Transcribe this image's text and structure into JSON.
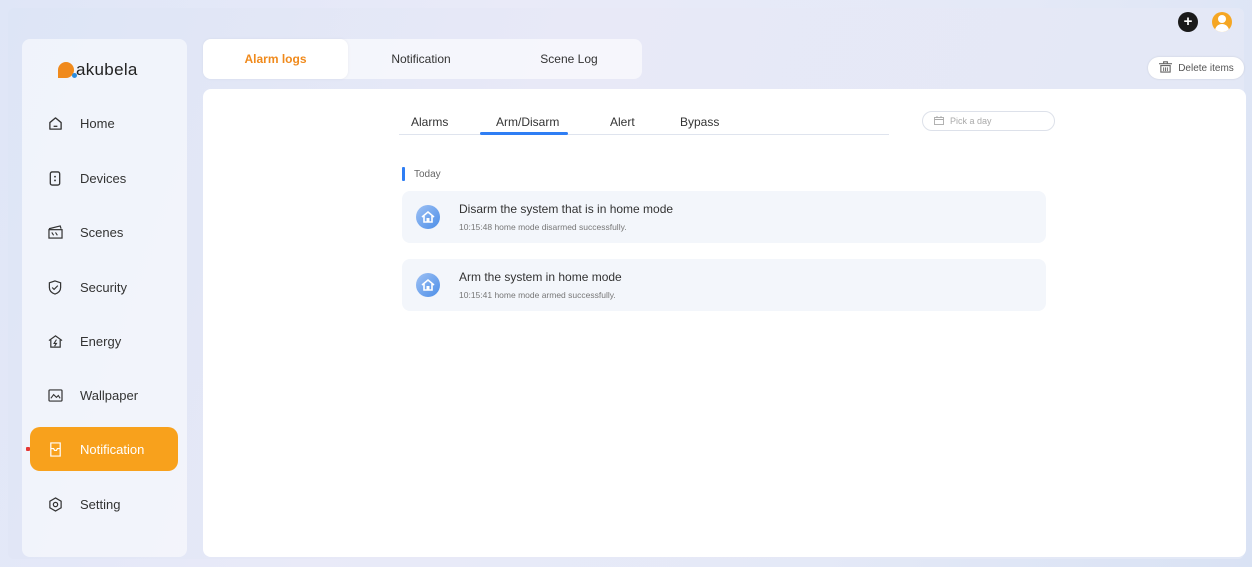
{
  "sidebar": {
    "logo_text": "akubela",
    "items": [
      {
        "label": "Home",
        "icon": "home-icon"
      },
      {
        "label": "Devices",
        "icon": "device-icon"
      },
      {
        "label": "Scenes",
        "icon": "scenes-icon"
      },
      {
        "label": "Security",
        "icon": "shield-icon"
      },
      {
        "label": "Energy",
        "icon": "energy-icon"
      },
      {
        "label": "Wallpaper",
        "icon": "wallpaper-icon"
      },
      {
        "label": "Notification",
        "icon": "notification-icon",
        "active": true
      },
      {
        "label": "Setting",
        "icon": "setting-icon"
      }
    ]
  },
  "top_tabs": [
    {
      "label": "Alarm logs",
      "active": true
    },
    {
      "label": "Notification"
    },
    {
      "label": "Scene Log"
    }
  ],
  "toolbar": {
    "delete_label": "Delete items"
  },
  "sub_tabs": [
    {
      "label": "Alarms"
    },
    {
      "label": "Arm/Disarm",
      "active": true
    },
    {
      "label": "Alert"
    },
    {
      "label": "Bypass"
    }
  ],
  "date_picker": {
    "placeholder": "Pick a day"
  },
  "log": {
    "section": "Today",
    "entries": [
      {
        "title": "Disarm the system that is in home mode",
        "detail": "10:15:48 home mode disarmed successfully."
      },
      {
        "title": "Arm the system in home mode",
        "detail": "10:15:41 home mode armed successfully."
      }
    ]
  },
  "colors": {
    "accent": "#f8a11c",
    "tab_active_text": "#f08a1c",
    "underline": "#2f7ef4"
  }
}
